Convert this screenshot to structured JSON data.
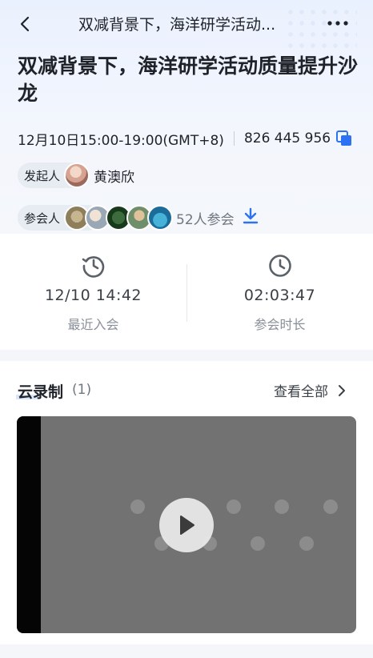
{
  "nav": {
    "title": "双减背景下，海洋研学活动..."
  },
  "meeting": {
    "title": "双减背景下，海洋研学活动质量提升沙龙",
    "time": "12月10日15:00-19:00(GMT+8)",
    "meeting_id": "826 445 956"
  },
  "initiator": {
    "label": "发起人",
    "name": "黄澳欣"
  },
  "attendees": {
    "label": "参会人",
    "count": "52人参会"
  },
  "stats": {
    "last_join": {
      "value": "12/10 14:42",
      "label": "最近入会"
    },
    "duration": {
      "value": "02:03:47",
      "label": "参会时长"
    }
  },
  "recording": {
    "title": "云录制",
    "count": "(1)",
    "view_all": "查看全部",
    "tiles": [
      "",
      "",
      "",
      "",
      "",
      "",
      "",
      ""
    ]
  },
  "colors": {
    "accent": "#2d72f2",
    "pill_bg": "#e7ebf2",
    "video_bg": "#727272"
  }
}
